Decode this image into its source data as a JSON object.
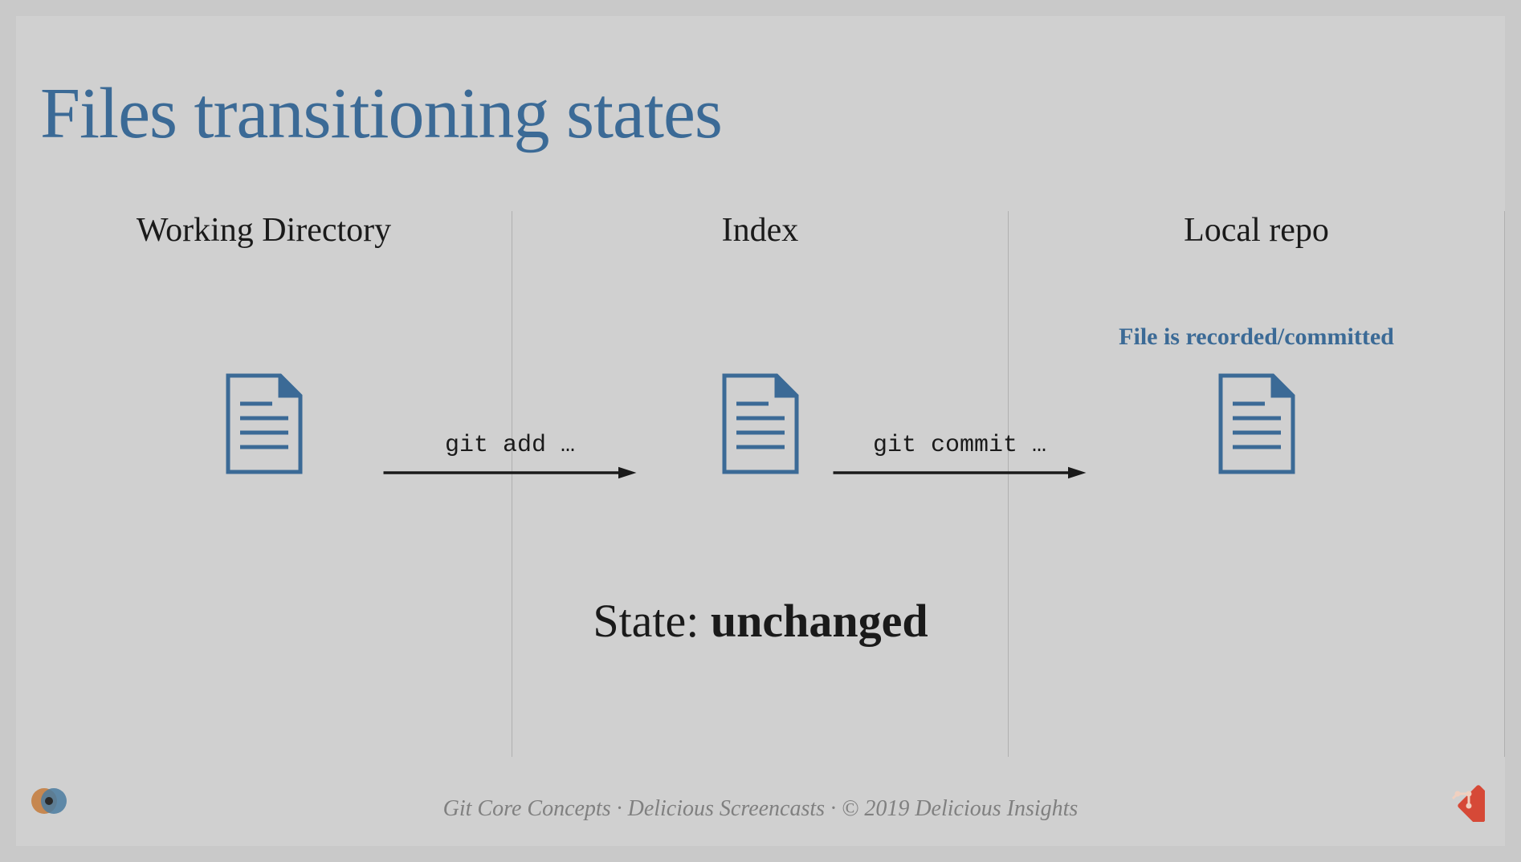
{
  "title": "Files transitioning states",
  "columns": {
    "working_directory": "Working Directory",
    "index": "Index",
    "local_repo": "Local repo"
  },
  "annotation": "File is recorded/committed",
  "arrows": {
    "add": "git add …",
    "commit": "git commit …"
  },
  "state": {
    "label": "State: ",
    "value": "unchanged"
  },
  "footer": "Git Core Concepts · Delicious Screencasts · © 2019 Delicious Insights",
  "colors": {
    "accent": "#3b6a96",
    "icon_stroke": "#3b6a96"
  }
}
